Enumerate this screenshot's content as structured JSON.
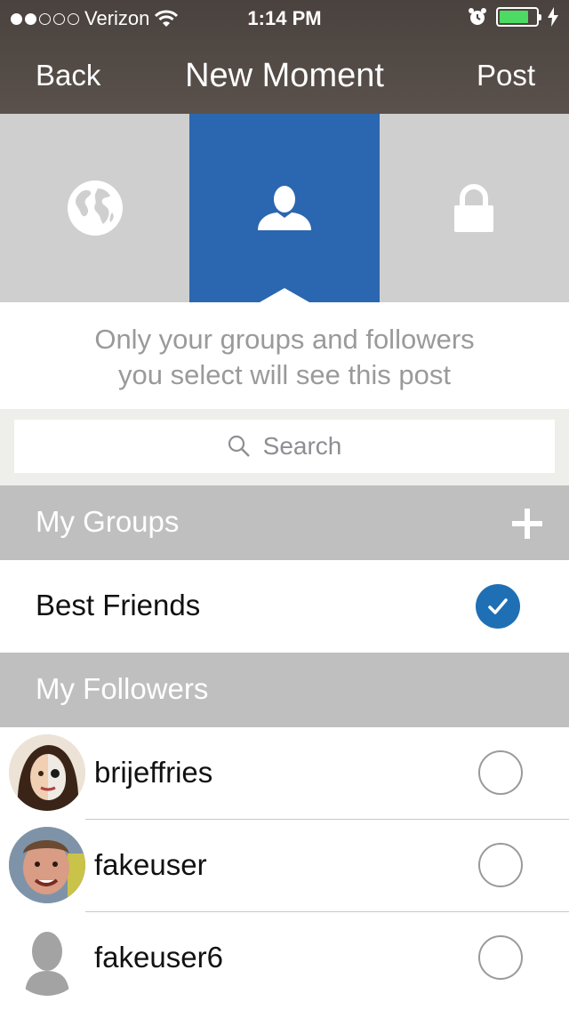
{
  "status_bar": {
    "carrier": "Verizon",
    "time": "1:14 PM"
  },
  "nav": {
    "back_label": "Back",
    "title": "New Moment",
    "post_label": "Post"
  },
  "privacy_tabs": [
    {
      "id": "public",
      "icon": "globe-icon",
      "selected": false
    },
    {
      "id": "followers",
      "icon": "person-icon",
      "selected": true
    },
    {
      "id": "private",
      "icon": "lock-icon",
      "selected": false
    }
  ],
  "description": {
    "line1": "Only your groups and followers",
    "line2": "you select will see this post"
  },
  "search": {
    "placeholder": "Search"
  },
  "groups": {
    "title": "My Groups",
    "items": [
      {
        "name": "Best Friends",
        "checked": true
      }
    ]
  },
  "followers": {
    "title": "My Followers",
    "items": [
      {
        "name": "brijeffries",
        "checked": false
      },
      {
        "name": "fakeuser",
        "checked": false
      },
      {
        "name": "fakeuser6",
        "checked": false
      }
    ]
  },
  "colors": {
    "nav_bg": "#4f4743",
    "active_tab": "#2b67b0",
    "section_bg": "#bfbfbf",
    "check_blue": "#1f6fb5"
  }
}
